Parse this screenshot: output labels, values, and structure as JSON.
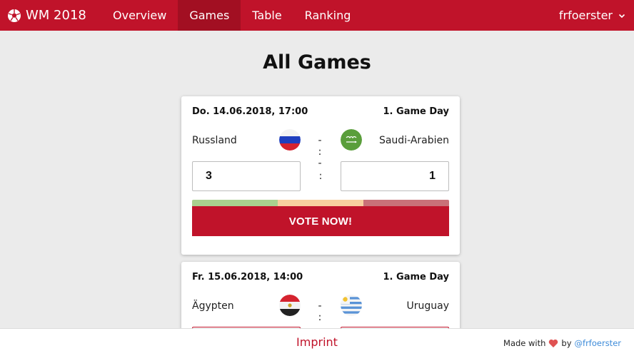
{
  "navbar": {
    "brand": "WM 2018",
    "brand_icon": "soccer-ball-icon",
    "items": [
      {
        "label": "Overview",
        "active": false
      },
      {
        "label": "Games",
        "active": true
      },
      {
        "label": "Table",
        "active": false
      },
      {
        "label": "Ranking",
        "active": false
      }
    ],
    "user": "frfoerster",
    "user_icon": "chevron-down-icon",
    "color": "#c0132a",
    "active_color": "#a20f22"
  },
  "page": {
    "title": "All Games"
  },
  "games": [
    {
      "datetime": "Do. 14.06.2018, 17:00",
      "game_day": "1. Game Day",
      "home_team": "Russland",
      "away_team": "Saudi-Arabien",
      "score": "- : -",
      "tip_home": "3",
      "tip_away": "1",
      "tip_separator": ":",
      "vote_label": "VOTE NOW!",
      "vote_colors": [
        "#a9d18e",
        "#f8cf9f",
        "#c97178"
      ]
    },
    {
      "datetime": "Fr. 15.06.2018, 14:00",
      "game_day": "1. Game Day",
      "home_team": "Ägypten",
      "away_team": "Uruguay",
      "score": "- : -"
    }
  ],
  "footer": {
    "imprint": "Imprint",
    "made_with_prefix": "Made with",
    "made_with_by": "by",
    "author": "@frfoerster",
    "heart_color": "#e05252"
  }
}
